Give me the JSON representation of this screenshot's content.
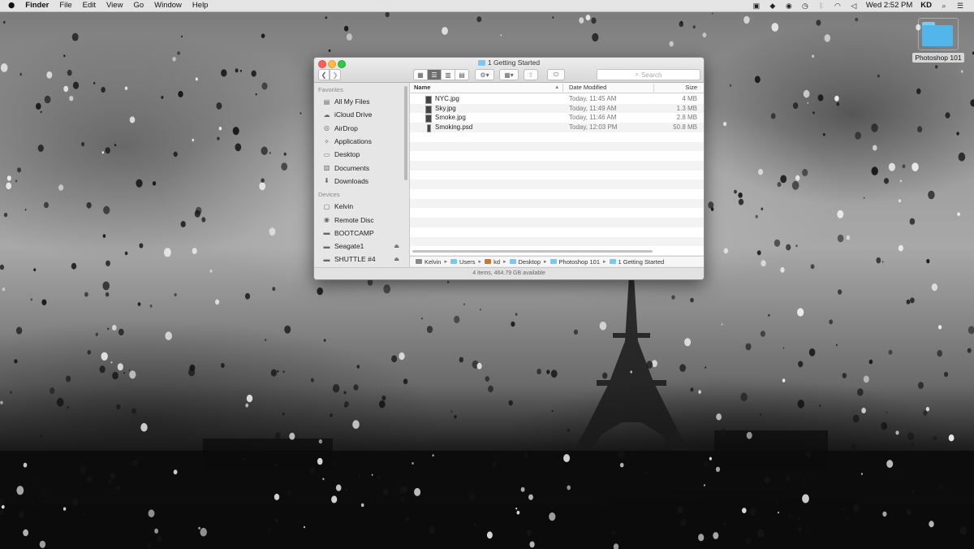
{
  "menubar": {
    "apple": "",
    "app": "Finder",
    "menus": [
      "File",
      "Edit",
      "View",
      "Go",
      "Window",
      "Help"
    ],
    "clock": "Wed 2:52 PM",
    "user": "KD"
  },
  "desktop": {
    "folder_label": "Photoshop 101"
  },
  "window": {
    "title": "1 Getting Started",
    "search_placeholder": "Search",
    "sidebar": {
      "favorites_header": "Favorites",
      "favorites": [
        {
          "label": "All My Files",
          "icon": "all-files-icon"
        },
        {
          "label": "iCloud Drive",
          "icon": "cloud-icon"
        },
        {
          "label": "AirDrop",
          "icon": "airdrop-icon"
        },
        {
          "label": "Applications",
          "icon": "applications-icon"
        },
        {
          "label": "Desktop",
          "icon": "desktop-icon"
        },
        {
          "label": "Documents",
          "icon": "documents-icon"
        },
        {
          "label": "Downloads",
          "icon": "downloads-icon"
        }
      ],
      "devices_header": "Devices",
      "devices": [
        {
          "label": "Kelvin",
          "icon": "computer-icon"
        },
        {
          "label": "Remote Disc",
          "icon": "disc-icon"
        },
        {
          "label": "BOOTCAMP",
          "icon": "drive-icon"
        },
        {
          "label": "Seagate1",
          "icon": "drive-icon",
          "eject": "⏏"
        },
        {
          "label": "SHUTTLE #4",
          "icon": "drive-icon",
          "eject": "⏏"
        }
      ]
    },
    "columns": {
      "name": "Name",
      "date": "Date Modified",
      "size": "Size"
    },
    "files": [
      {
        "name": "NYC.jpg",
        "date": "Today, 11:45 AM",
        "size": "4 MB"
      },
      {
        "name": "Sky.jpg",
        "date": "Today, 11:49 AM",
        "size": "1.3 MB"
      },
      {
        "name": "Smoke.jpg",
        "date": "Today, 11:46 AM",
        "size": "2.8 MB"
      },
      {
        "name": "Smoking.psd",
        "date": "Today, 12:03 PM",
        "size": "50.8 MB"
      }
    ],
    "path": [
      "Kelvin",
      "Users",
      "kd",
      "Desktop",
      "Photoshop 101",
      "1 Getting Started"
    ],
    "status": "4 items, 464.79 GB available"
  }
}
